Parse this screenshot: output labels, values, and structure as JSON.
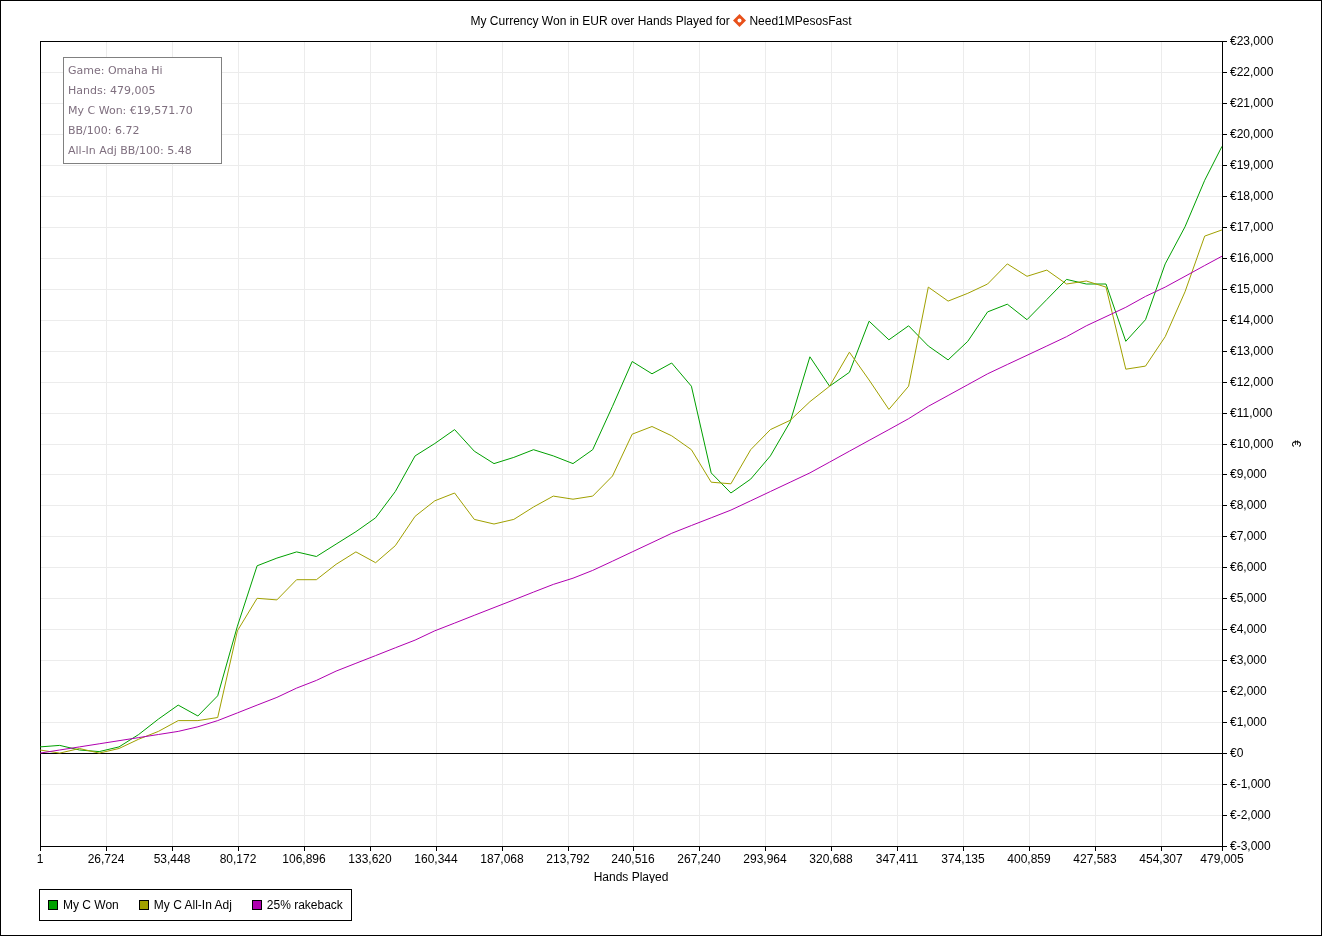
{
  "header": {
    "title": "My Currency Won in EUR over Hands Played for",
    "player": "Need1MPesosFast"
  },
  "stats": [
    "Game: Omaha Hi",
    "Hands: 479,005",
    "My C Won: €19,571.70",
    "BB/100: 6.72",
    "All-In Adj BB/100: 5.48"
  ],
  "chart_data": {
    "type": "line",
    "xlabel": "Hands Played",
    "ylabel": "€",
    "x": [
      1,
      8000,
      16000,
      24000,
      32000,
      40000,
      48000,
      56000,
      64000,
      72000,
      80000,
      88000,
      96000,
      104000,
      112000,
      120000,
      128000,
      136000,
      144000,
      152000,
      160000,
      168000,
      176000,
      184000,
      192000,
      200000,
      208000,
      216000,
      224000,
      232000,
      240000,
      248000,
      256000,
      264000,
      272000,
      280000,
      288000,
      296000,
      304000,
      312000,
      320000,
      328000,
      336000,
      344000,
      352000,
      360000,
      368000,
      376000,
      384000,
      392000,
      400000,
      408000,
      416000,
      424000,
      432000,
      440000,
      448000,
      456000,
      464000,
      472000,
      479005
    ],
    "series": [
      {
        "name": "My C Won",
        "color": "#00a000",
        "values": [
          200,
          250,
          100,
          50,
          200,
          600,
          1100,
          1550,
          1200,
          1850,
          4100,
          6050,
          6300,
          6500,
          6350,
          6750,
          7150,
          7600,
          8450,
          9600,
          10000,
          10450,
          9750,
          9350,
          9550,
          9800,
          9600,
          9350,
          9800,
          11200,
          12650,
          12250,
          12600,
          11850,
          9050,
          8400,
          8850,
          9600,
          10700,
          12800,
          11850,
          12300,
          13950,
          13350,
          13800,
          13150,
          12700,
          13300,
          14250,
          14500,
          14000,
          14650,
          15300,
          15150,
          15150,
          13300,
          14000,
          15800,
          17000,
          18500,
          19600
        ]
      },
      {
        "name": "My C All-In Adj",
        "color": "#a0a000",
        "values": [
          100,
          0,
          150,
          0,
          150,
          450,
          700,
          1050,
          1050,
          1150,
          3950,
          5000,
          4950,
          5600,
          5600,
          6100,
          6500,
          6150,
          6700,
          7650,
          8150,
          8400,
          7550,
          7400,
          7550,
          7950,
          8300,
          8200,
          8300,
          8950,
          10300,
          10550,
          10250,
          9800,
          8750,
          8700,
          9800,
          10450,
          10750,
          11350,
          11850,
          12950,
          12050,
          11100,
          11850,
          15050,
          14600,
          14850,
          15150,
          15800,
          15400,
          15600,
          15150,
          15250,
          15050,
          12400,
          12500,
          13450,
          14900,
          16700,
          16900
        ]
      },
      {
        "name": "25% rakeback",
        "color": "#b000b0",
        "values": [
          0,
          100,
          200,
          300,
          400,
          500,
          600,
          700,
          850,
          1050,
          1300,
          1550,
          1800,
          2100,
          2350,
          2650,
          2900,
          3150,
          3400,
          3650,
          3950,
          4200,
          4450,
          4700,
          4950,
          5200,
          5450,
          5650,
          5900,
          6200,
          6500,
          6800,
          7100,
          7350,
          7600,
          7850,
          8150,
          8450,
          8750,
          9050,
          9400,
          9750,
          10100,
          10450,
          10800,
          11200,
          11550,
          11900,
          12250,
          12550,
          12850,
          13150,
          13450,
          13800,
          14100,
          14400,
          14750,
          15050,
          15400,
          15750,
          16050
        ]
      }
    ],
    "grid": true,
    "xlim": [
      1,
      479005
    ],
    "ylim": [
      -3000,
      23000
    ],
    "xticks": [
      {
        "value": 1,
        "label": "1"
      },
      {
        "value": 26724,
        "label": "26,724"
      },
      {
        "value": 53448,
        "label": "53,448"
      },
      {
        "value": 80172,
        "label": "80,172"
      },
      {
        "value": 106896,
        "label": "106,896"
      },
      {
        "value": 133620,
        "label": "133,620"
      },
      {
        "value": 160344,
        "label": "160,344"
      },
      {
        "value": 187068,
        "label": "187,068"
      },
      {
        "value": 213792,
        "label": "213,792"
      },
      {
        "value": 240516,
        "label": "240,516"
      },
      {
        "value": 267240,
        "label": "267,240"
      },
      {
        "value": 293964,
        "label": "293,964"
      },
      {
        "value": 320688,
        "label": "320,688"
      },
      {
        "value": 347411,
        "label": "347,411"
      },
      {
        "value": 374135,
        "label": "374,135"
      },
      {
        "value": 400859,
        "label": "400,859"
      },
      {
        "value": 427583,
        "label": "427,583"
      },
      {
        "value": 454307,
        "label": "454,307"
      },
      {
        "value": 479005,
        "label": "479,005"
      }
    ],
    "yticks": [
      {
        "value": -3000,
        "label": "€-3,000"
      },
      {
        "value": -2000,
        "label": "€-2,000"
      },
      {
        "value": -1000,
        "label": "€-1,000"
      },
      {
        "value": 0,
        "label": "€0"
      },
      {
        "value": 1000,
        "label": "€1,000"
      },
      {
        "value": 2000,
        "label": "€2,000"
      },
      {
        "value": 3000,
        "label": "€3,000"
      },
      {
        "value": 4000,
        "label": "€4,000"
      },
      {
        "value": 5000,
        "label": "€5,000"
      },
      {
        "value": 6000,
        "label": "€6,000"
      },
      {
        "value": 7000,
        "label": "€7,000"
      },
      {
        "value": 8000,
        "label": "€8,000"
      },
      {
        "value": 9000,
        "label": "€9,000"
      },
      {
        "value": 10000,
        "label": "€10,000"
      },
      {
        "value": 11000,
        "label": "€11,000"
      },
      {
        "value": 12000,
        "label": "€12,000"
      },
      {
        "value": 13000,
        "label": "€13,000"
      },
      {
        "value": 14000,
        "label": "€14,000"
      },
      {
        "value": 15000,
        "label": "€15,000"
      },
      {
        "value": 16000,
        "label": "€16,000"
      },
      {
        "value": 17000,
        "label": "€17,000"
      },
      {
        "value": 18000,
        "label": "€18,000"
      },
      {
        "value": 19000,
        "label": "€19,000"
      },
      {
        "value": 20000,
        "label": "€20,000"
      },
      {
        "value": 21000,
        "label": "€21,000"
      },
      {
        "value": 22000,
        "label": "€22,000"
      },
      {
        "value": 23000,
        "label": "€23,000"
      }
    ]
  }
}
